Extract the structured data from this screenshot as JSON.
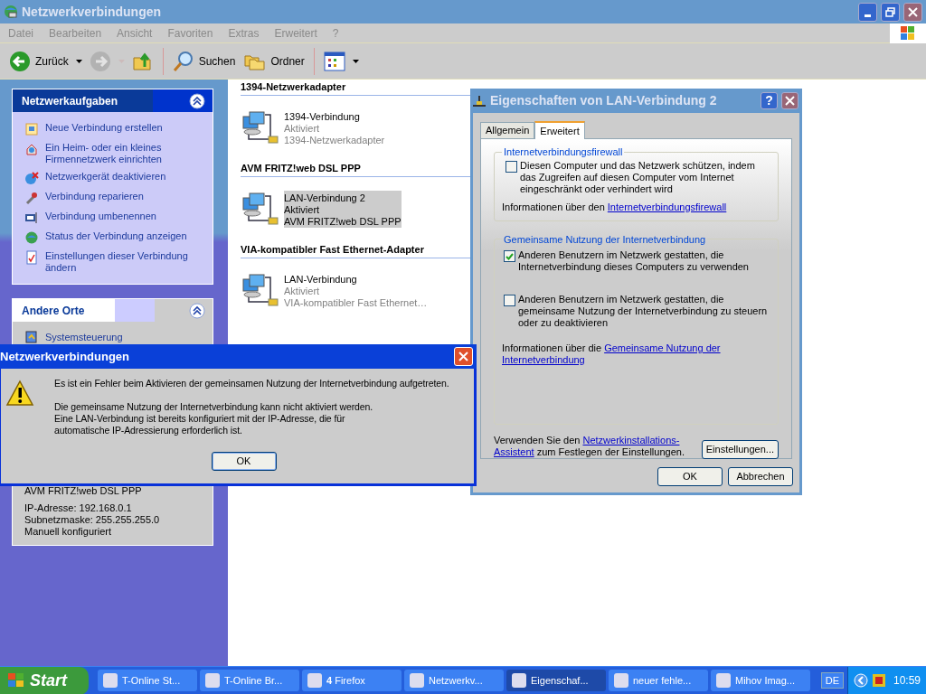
{
  "main_window": {
    "title": "Netzwerkverbindungen",
    "menu": [
      "Datei",
      "Bearbeiten",
      "Ansicht",
      "Favoriten",
      "Extras",
      "Erweitert",
      "?"
    ],
    "toolbar": [
      {
        "kind": "back",
        "label": "Zurück",
        "disabled": false
      },
      {
        "kind": "forward",
        "disabled": true
      },
      {
        "kind": "up",
        "disabled": false
      },
      {
        "kind": "search",
        "label": "Suchen",
        "disabled": false
      },
      {
        "kind": "folders",
        "label": "Ordner",
        "disabled": false
      },
      {
        "kind": "views",
        "disabled": false
      }
    ],
    "tasks_panel": {
      "title": "Netzwerkaufgaben",
      "items": [
        "Neue Verbindung erstellen",
        "Ein Heim- oder ein kleines Firmennetzwerk einrichten",
        "Netzwerkgerät deaktivieren",
        "Verbindung reparieren",
        "Verbindung umbenennen",
        "Status der Verbindung anzeigen",
        "Einstellungen dieser Verbindung ändern"
      ]
    },
    "other_places": {
      "title": "Andere Orte",
      "items": [
        "Systemsteuerung"
      ]
    },
    "details": {
      "lines": [
        "AVM FRITZ!web DSL PPP",
        "IP-Adresse: 192.168.0.1",
        "Subnetzmaske: 255.255.255.0",
        "Manuell konfiguriert"
      ]
    },
    "groups": [
      {
        "title": "1394-Netzwerkadapter",
        "items": [
          {
            "name": "1394-Verbindung",
            "status": "Aktiviert",
            "adapter": "1394-Netzwerkadapter",
            "selected": false
          }
        ]
      },
      {
        "title": "AVM FRITZ!web DSL PPP",
        "items": [
          {
            "name": "LAN-Verbindung 2",
            "status": "Aktiviert",
            "adapter": "AVM FRITZ!web DSL PPP",
            "selected": true
          }
        ]
      },
      {
        "title": "VIA-kompatibler Fast Ethernet-Adapter",
        "items": [
          {
            "name": "LAN-Verbindung",
            "status": "Aktiviert",
            "adapter": "VIA-kompatibler Fast Ethernet…",
            "selected": false
          }
        ]
      }
    ]
  },
  "properties_dialog": {
    "title": "Eigenschaften von LAN-Verbindung 2",
    "tabs": [
      {
        "label": "Allgemein",
        "selected": false
      },
      {
        "label": "Erweitert",
        "selected": true
      }
    ],
    "firewall": {
      "title": "Internetverbindungsfirewall",
      "option": {
        "label": "Diesen Computer und das Netzwerk schützen, indem das Zugreifen auf diesen Computer vom Internet eingeschränkt oder verhindert wird",
        "checked": false
      },
      "info": [
        {
          "text": "Informationen über den ",
          "link": "Internetverbindungsfirewall"
        }
      ]
    },
    "sharing": {
      "title": "Gemeinsame Nutzung der Internetverbindung",
      "options": [
        {
          "label": "Anderen Benutzern im Netzwerk gestatten, die Internetverbindung dieses Computers zu verwenden",
          "checked": true
        },
        {
          "label": "Anderen Benutzern im Netzwerk gestatten, die gemeinsame Nutzung der Internetverbindung zu steuern oder zu deaktivieren",
          "checked": false
        }
      ],
      "info": [
        {
          "text": "Informationen über die ",
          "link": "Gemeinsame Nutzung der"
        },
        {
          "link": "Internetverbindung"
        }
      ]
    },
    "footer": [
      {
        "text": "Verwenden Sie den ",
        "link": "Netzwerkinstallations-"
      },
      {
        "link": "Assistent",
        "after": " zum Festlegen der Einstellungen."
      }
    ],
    "help_button": "?",
    "settings_button": "Einstellungen...",
    "buttons": [
      "OK",
      "Abbrechen"
    ]
  },
  "error_dialog": {
    "title": "Netzwerkverbindungen",
    "message": "Es ist ein Fehler beim Aktivieren der gemeinsamen Nutzung der Internetverbindung aufgetreten.",
    "details": [
      "Die gemeinsame Nutzung der Internetverbindung kann nicht aktiviert werden.",
      "Eine LAN-Verbindung ist bereits konfiguriert mit der IP-Adresse, die für",
      "automatische IP-Adressierung erforderlich ist."
    ],
    "button": "OK"
  },
  "taskbar": {
    "start": "Start",
    "tasks": [
      {
        "label": "T-Online St...",
        "selected": false
      },
      {
        "label": "T-Online Br...",
        "selected": false
      },
      {
        "label": "**4** Firefox",
        "selected": false
      },
      {
        "label": "Netzwerkv...",
        "selected": false
      },
      {
        "label": "Eigenschaf...",
        "selected": true
      },
      {
        "label": "neuer fehle...",
        "selected": false
      },
      {
        "label": "Mihov Imag...",
        "selected": false
      }
    ],
    "language": "DE",
    "clock": "10:59"
  }
}
